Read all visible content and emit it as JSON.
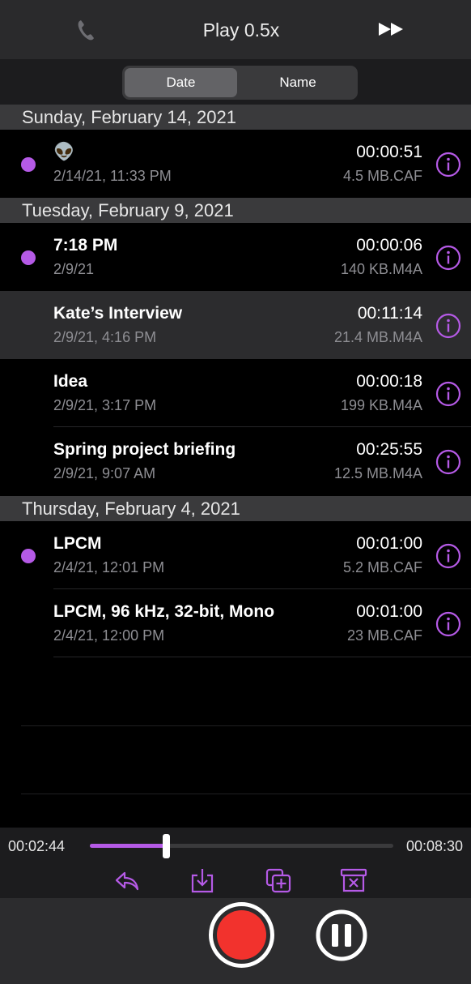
{
  "header": {
    "title": "Play 0.5x",
    "left_icon": "phone-icon",
    "right_icon": "fast-forward-icon"
  },
  "segmented": {
    "options": [
      "Date",
      "Name"
    ],
    "selected": "Date"
  },
  "sections": [
    {
      "title": "Sunday, February 14, 2021",
      "items": [
        {
          "title": "👽",
          "date": "2/14/21, 11:33 PM",
          "duration": "00:00:51",
          "size": "4.5 MB.CAF",
          "unplayed": true
        }
      ]
    },
    {
      "title": "Tuesday, February 9, 2021",
      "items": [
        {
          "title": "7:18 PM",
          "date": "2/9/21",
          "duration": "00:00:06",
          "size": "140 KB.M4A",
          "unplayed": true
        },
        {
          "title": "Kate’s Interview",
          "date": "2/9/21, 4:16 PM",
          "duration": "00:11:14",
          "size": "21.4 MB.M4A",
          "unplayed": false,
          "selected": true
        },
        {
          "title": "Idea",
          "date": "2/9/21, 3:17 PM",
          "duration": "00:00:18",
          "size": "199 KB.M4A",
          "unplayed": false
        },
        {
          "title": "Spring project briefing",
          "date": "2/9/21, 9:07 AM",
          "duration": "00:25:55",
          "size": "12.5 MB.M4A",
          "unplayed": false
        }
      ]
    },
    {
      "title": "Thursday, February 4, 2021",
      "items": [
        {
          "title": "LPCM",
          "date": "2/4/21, 12:01 PM",
          "duration": "00:01:00",
          "size": "5.2 MB.CAF",
          "unplayed": true
        },
        {
          "title": "LPCM, 96 kHz, 32-bit, Mono",
          "date": "2/4/21, 12:00 PM",
          "duration": "00:01:00",
          "size": "23 MB.CAF",
          "unplayed": false
        }
      ]
    }
  ],
  "player": {
    "current_time": "00:02:44",
    "total_time": "00:08:30",
    "progress": 0.25,
    "tools": [
      "reply-icon",
      "export-icon",
      "duplicate-icon",
      "delete-icon"
    ]
  },
  "controls": {
    "record": "record-button",
    "pause": "pause-button"
  },
  "colors": {
    "accent": "#b55ae6",
    "record": "#f2322d",
    "background": "#000000",
    "bar": "#2a2a2c"
  }
}
